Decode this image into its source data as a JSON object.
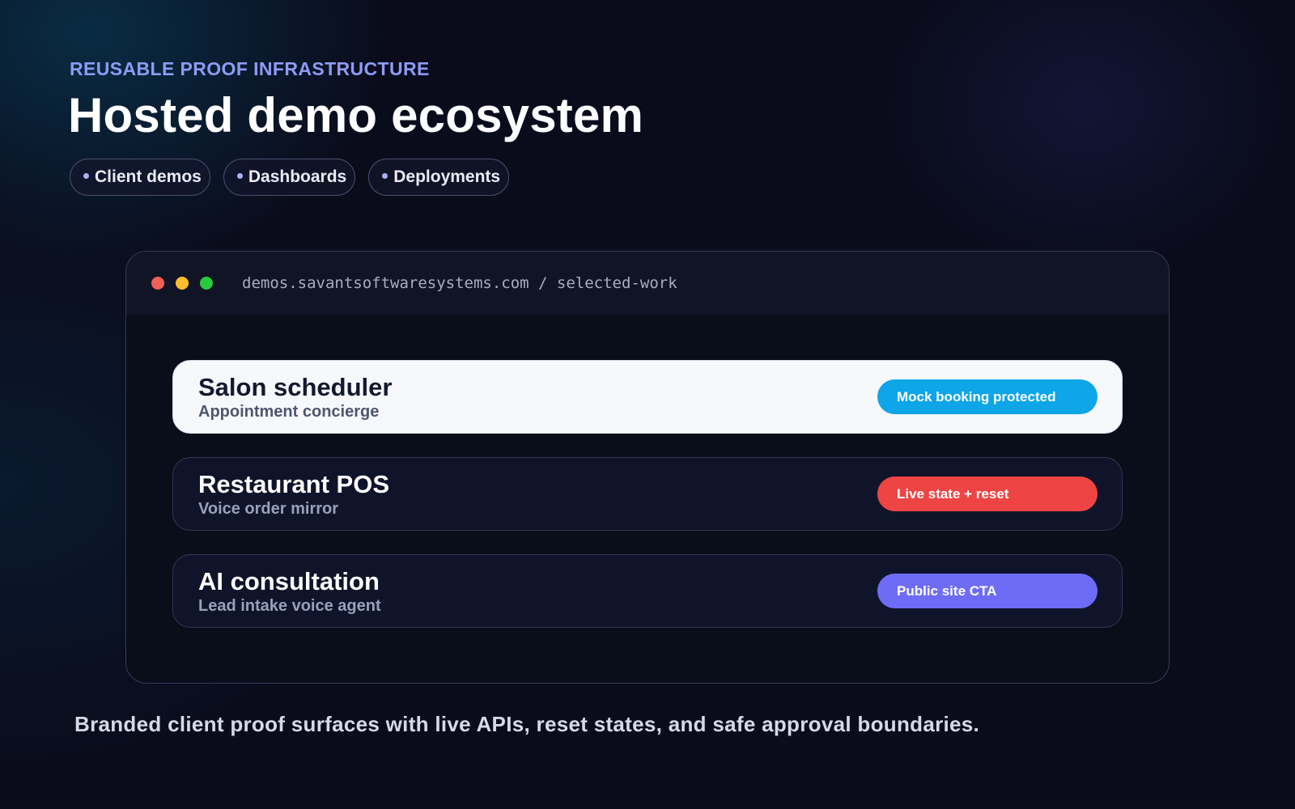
{
  "header": {
    "eyebrow": "REUSABLE PROOF INFRASTRUCTURE",
    "title": "Hosted demo ecosystem",
    "pills": [
      {
        "label": "Client demos"
      },
      {
        "label": "Dashboards"
      },
      {
        "label": "Deployments"
      }
    ]
  },
  "browser": {
    "url": "demos.savantsoftwaresystems.com / selected-work",
    "cards": [
      {
        "title": "Salon scheduler",
        "subtitle": "Appointment concierge",
        "badge": "Mock booking protected",
        "badge_color": "#0ea5e9"
      },
      {
        "title": "Restaurant POS",
        "subtitle": "Voice order mirror",
        "badge": "Live state + reset",
        "badge_color": "#ef4444"
      },
      {
        "title": "AI consultation",
        "subtitle": "Lead intake voice agent",
        "badge": "Public site CTA",
        "badge_color": "#6e6cf6"
      }
    ]
  },
  "footer": {
    "text": "Branded client proof surfaces with live APIs, reset states, and safe approval boundaries."
  }
}
